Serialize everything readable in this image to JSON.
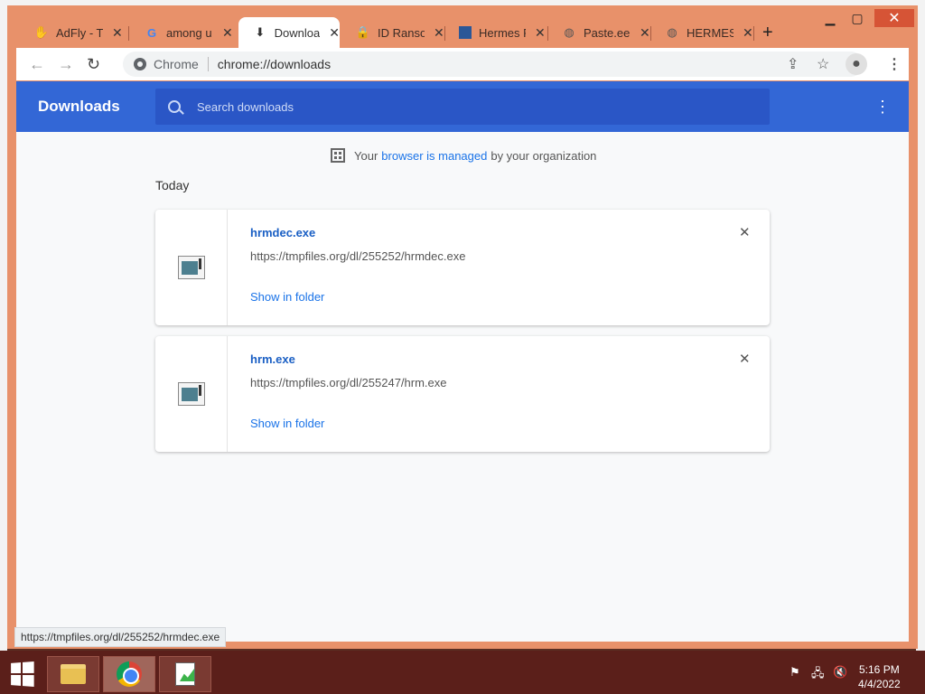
{
  "window": {
    "controls": {
      "minimize": "▁",
      "maximize": "▢",
      "close": "✕"
    }
  },
  "tabs": [
    {
      "title": "AdFly - The",
      "icon": "adfly-icon",
      "active": false
    },
    {
      "title": "among u",
      "icon": "google-icon",
      "active": false
    },
    {
      "title": "Downloads",
      "icon": "download-icon",
      "active": true
    },
    {
      "title": "ID Ransom",
      "icon": "lock-icon",
      "active": false
    },
    {
      "title": "Hermes R",
      "icon": "page-icon",
      "active": false
    },
    {
      "title": "Paste.ee",
      "icon": "globe-icon",
      "active": false
    },
    {
      "title": "HERMES",
      "icon": "globe-icon",
      "active": false
    }
  ],
  "new_tab_label": "+",
  "tab_close_label": "✕",
  "toolbar": {
    "back": "←",
    "forward": "→",
    "reload": "↻",
    "omnibox_scheme_label": "Chrome",
    "omnibox_url": "chrome://downloads",
    "share": "⇪",
    "star": "☆",
    "profile": "●",
    "menu": "⋮"
  },
  "page": {
    "title": "Downloads",
    "search_placeholder": "Search downloads",
    "menu": "⋮",
    "managed_prefix": "Your",
    "managed_link": "browser is managed",
    "managed_suffix": "by your organization",
    "section_label": "Today",
    "downloads": [
      {
        "filename": "hrmdec.exe",
        "url": "https://tmpfiles.org/dl/255252/hrmdec.exe",
        "action": "Show in folder",
        "remove": "✕"
      },
      {
        "filename": "hrm.exe",
        "url": "https://tmpfiles.org/dl/255247/hrm.exe",
        "action": "Show in folder",
        "remove": "✕"
      }
    ]
  },
  "status_bar": "https://tmpfiles.org/dl/255252/hrmdec.exe",
  "taskbar": {
    "apps": [
      "file-explorer-icon",
      "chrome-icon",
      "notepad-icon"
    ],
    "tray": {
      "flag": "⚑",
      "network": "🖧",
      "volume": "🔇"
    },
    "time": "5:16 PM",
    "date": "4/4/2022"
  },
  "colors": {
    "window_frame": "#e8916a",
    "header_blue": "#3367d6",
    "search_blue": "#2a56c6",
    "link_blue": "#1a73e8",
    "taskbar": "#5b1f1a"
  }
}
